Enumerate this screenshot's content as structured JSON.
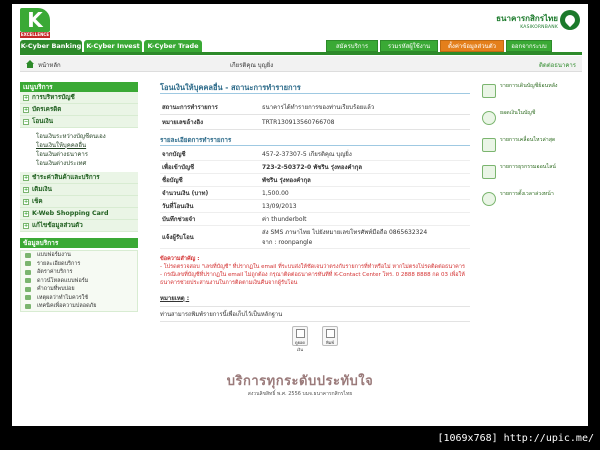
{
  "header": {
    "logo_letter": "K",
    "logo_sub": "EXCELLENCE",
    "bank_name_th": "ธนาคารกสิกรไทย",
    "bank_name_en": "KASIKORNBANK"
  },
  "topnav": {
    "tabs": [
      "K-Cyber Banking",
      "K-Cyber Invest",
      "K-Cyber Trade"
    ],
    "right": [
      "สมัครบริการ",
      "รวมรหัสผู้ใช้งาน",
      "ตั้งค่าข้อมูลส่วนตัว",
      "ออกจากระบบ"
    ]
  },
  "subbar": {
    "home": "หน้าหลัก",
    "user": "เกียรติคุณ บุญยิ่ง",
    "contact": "ติดต่อธนาคาร"
  },
  "sidebar": {
    "menu_title": "เมนูบริการ",
    "items": [
      {
        "label": "การบริหารบัญชี"
      },
      {
        "label": "บัตรเครดิต"
      },
      {
        "label": "โอนเงิน"
      }
    ],
    "sub_items": [
      "โอนเงินระหว่างบัญชีตนเอง",
      "โอนเงินให้บุคคลอื่น",
      "โอนเงินต่างธนาคาร",
      "โอนเงินต่างประเทศ"
    ],
    "items2": [
      {
        "label": "ชำระค่าสินค้าและบริการ"
      },
      {
        "label": "เติมเงิน"
      },
      {
        "label": "เช็ค"
      },
      {
        "label": "K-Web Shopping Card"
      },
      {
        "label": "แก้ไขข้อมูลส่วนตัว"
      }
    ],
    "info_title": "ข้อมูลบริการ",
    "info_items": [
      "แบบฟอร์มงาน",
      "รายละเอียดบริการ",
      "อัตราค่าบริการ",
      "ดาวน์โหลดแบบฟอร์ม",
      "คำถามที่พบบ่อย",
      "เหตุผลว่าทำไมควรใช้",
      "เทคนิคเพื่อความปลอดภัย"
    ]
  },
  "main": {
    "title": "โอนเงินให้บุคคลอื่น - สถานะการทำรายการ",
    "status_label": "สถานะการทำรายการ",
    "status_value": "ธนาคารได้ทำรายการของท่านเรียบร้อยแล้ว",
    "ref_label": "หมายเลขอ้างอิง",
    "ref_value": "TRTR130913560766708",
    "detail_title": "รายละเอียดการทำรายการ",
    "rows": [
      {
        "label": "จากบัญชี",
        "value": "457-2-37307-5 เกียรติคุณ บุญยิ่ง"
      },
      {
        "label": "เพื่อเข้าบัญชี",
        "value": "723-2-50372-0 พัชริน รุ่งทองคำกุล"
      },
      {
        "label": "ชื่อบัญชี",
        "value": "พัชริน รุ่งทองคำกุล"
      },
      {
        "label": "จำนวนเงิน (บาท)",
        "value": "1,500.00"
      },
      {
        "label": "วันที่โอนเงิน",
        "value": "13/09/2013"
      },
      {
        "label": "บันทึกช่วยจำ",
        "value": "ค่า thunderbolt"
      },
      {
        "label": "แจ้งผู้รับโอน",
        "value": "ส่ง SMS ภาษาไทย ไปยังหมายเลขโทรศัพท์มือถือ 0865632324"
      }
    ],
    "notify_line2": "จาก : roonpangle",
    "notes_heading": "ข้อความสำคัญ :",
    "notes": [
      "- โปรดตรวจสอบ \"เลขที่บัญชี\" ที่ปรากฏใน email ที่ระบบส่งให้ชัดเจนว่าตรงกับรายการที่ทำหรือไม่ หากไม่ตรงโปรดติดต่อธนาคาร",
      "- กรณีเลขที่บัญชีที่ปรากฏใน email ไม่ถูกต้อง กรุณาติดต่อธนาคารทันทีที่ K-Contact Center โทร. 0 2888 8888 กด 03 เพื่อให้ธนาคารช่วยประสานงานในการติดตามเงินคืนจากผู้รับโอน"
    ],
    "remark_heading": "หมายเหตุ :",
    "remark": "ท่านสามารถพิมพ์รายการนี้เพื่อเก็บไว้เป็นหลักฐาน",
    "btn_save": "ดูยอดเงิน",
    "btn_print": "พิมพ์"
  },
  "rside": {
    "items": [
      "รายการเดินบัญชีย้อนหลัง",
      "ยอดเงินในบัญชี",
      "รายการเคลื่อนไหวล่าสุด",
      "รายการธุรกรรมออนไลน์",
      "รายการตั้งเวลาล่วงหน้า"
    ]
  },
  "footer": {
    "tagline": "บริการทุกระดับประทับใจ",
    "copyright": "สงวนลิขสิทธิ์ พ.ศ. 2556 บมจ.ธนาคารกสิกรไทย"
  },
  "watermark": "[1069x768] http://upic.me/"
}
